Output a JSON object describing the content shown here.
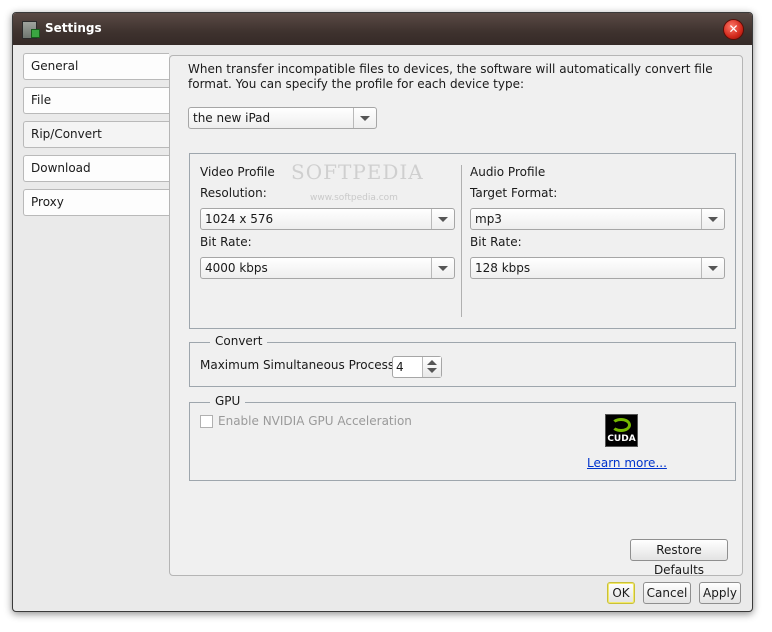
{
  "window": {
    "title": "Settings",
    "close_glyph": "✕"
  },
  "sidebar": {
    "items": [
      {
        "label": "General"
      },
      {
        "label": "File"
      },
      {
        "label": "Rip/Convert",
        "active": true
      },
      {
        "label": "Download"
      },
      {
        "label": "Proxy"
      }
    ]
  },
  "rip_convert": {
    "intro": "When transfer incompatible files to devices, the software will automatically convert file format. You can specify the profile for each device type:",
    "device_type": {
      "selected": "the new iPad"
    },
    "video_profile": {
      "heading": "Video Profile",
      "resolution_label": "Resolution:",
      "resolution_value": "1024 x 576",
      "bitrate_label": "Bit Rate:",
      "bitrate_value": "4000 kbps"
    },
    "audio_profile": {
      "heading": "Audio Profile",
      "format_label": "Target Format:",
      "format_value": "mp3",
      "bitrate_label": "Bit Rate:",
      "bitrate_value": "128 kbps"
    },
    "convert": {
      "legend": "Convert",
      "max_processes_label": "Maximum Simultaneous Processes:",
      "max_processes_value": "4"
    },
    "gpu": {
      "legend": "GPU",
      "enable_label": "Enable NVIDIA GPU Acceleration",
      "enabled": false,
      "badge_text": "CUDA",
      "learn_more": "Learn more..."
    },
    "restore_defaults": "Restore Defaults"
  },
  "footer": {
    "ok": "OK",
    "cancel": "Cancel",
    "apply": "Apply"
  },
  "watermark": {
    "text": "SOFTPEDIA",
    "url": "www.softpedia.com"
  },
  "colors": {
    "titlebar": "#3e322e",
    "link": "#0033cc",
    "close": "#d1281b",
    "cuda_green": "#76b900"
  }
}
